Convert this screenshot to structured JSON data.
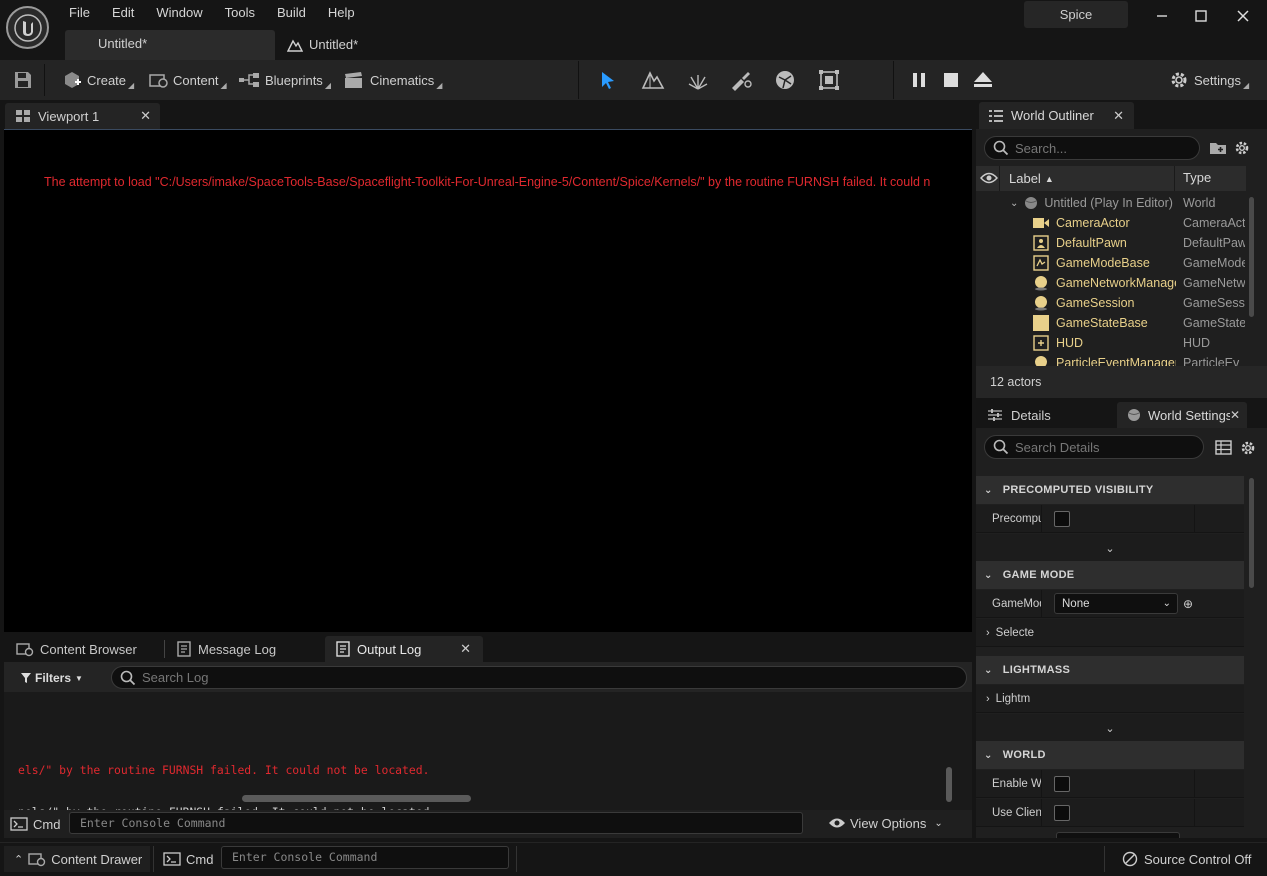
{
  "menu": [
    "File",
    "Edit",
    "Window",
    "Tools",
    "Build",
    "Help"
  ],
  "doc_tabs": [
    "Untitled*",
    "Untitled*"
  ],
  "project_name": "Spice",
  "toolbar": {
    "create": "Create",
    "content": "Content",
    "blueprints": "Blueprints",
    "cinematics": "Cinematics",
    "settings": "Settings"
  },
  "viewport": {
    "tab": "Viewport 1",
    "error": "The attempt to load \"C:/Users/imake/SpaceTools-Base/Spaceflight-Toolkit-For-Unreal-Engine-5/Content/Spice/Kernels/\" by the routine FURNSH failed. It could n"
  },
  "bottom_tabs": {
    "content_browser": "Content Browser",
    "message_log": "Message Log",
    "output_log": "Output Log"
  },
  "output_log": {
    "filters": "Filters",
    "search_placeholder": "Search Log",
    "lines": [
      {
        "text": "els/\" by the routine FURNSH failed. It could not be located.",
        "color": "#e0292f"
      },
      {
        "text": "nels/\" by the routine FURNSH failed. It could not be located.",
        "color": "#d0d0d0"
      }
    ],
    "cmd_label": "Cmd",
    "cmd_placeholder": "Enter Console Command",
    "view_options": "View Options"
  },
  "statusbar": {
    "content_drawer": "Content Drawer",
    "cmd_label": "Cmd",
    "cmd_placeholder": "Enter Console Command",
    "source_control": "Source Control Off"
  },
  "outliner": {
    "tab": "World Outliner",
    "search_placeholder": "Search...",
    "col_label": "Label",
    "col_type": "Type",
    "root_label": "Untitled (Play In Editor)",
    "root_type": "World",
    "items": [
      {
        "label": "CameraActor",
        "type": "CameraAct"
      },
      {
        "label": "DefaultPawn",
        "type": "DefaultPaw"
      },
      {
        "label": "GameModeBase",
        "type": "GameMode"
      },
      {
        "label": "GameNetworkManager",
        "type": "GameNetw"
      },
      {
        "label": "GameSession",
        "type": "GameSess"
      },
      {
        "label": "GameStateBase",
        "type": "GameState"
      },
      {
        "label": "HUD",
        "type": "HUD"
      },
      {
        "label": "ParticleEventManager",
        "type": "ParticleEv"
      }
    ],
    "count": "12 actors"
  },
  "details": {
    "tab_details": "Details",
    "tab_world_settings": "World Settings",
    "search_placeholder": "Search Details",
    "categories": {
      "precomputed_visibility": "PRECOMPUTED VISIBILITY",
      "game_mode": "GAME MODE",
      "lightmass": "LIGHTMASS",
      "world": "WORLD"
    },
    "props": {
      "precompute": "Precompu",
      "gamemode": "GameMod",
      "gamemode_value": "None",
      "selected": "Selecte",
      "lightmass": "Lightm",
      "enable_world": "Enable Wo",
      "use_client": "Use Client"
    }
  }
}
